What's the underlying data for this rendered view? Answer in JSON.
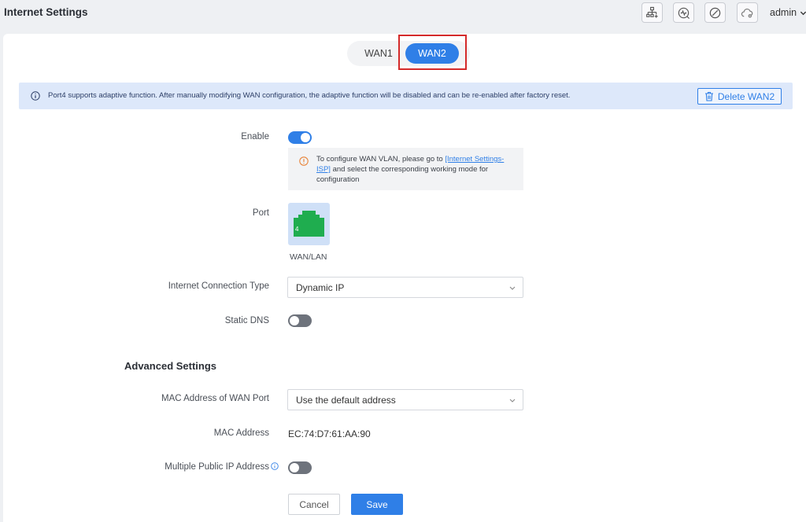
{
  "header": {
    "title": "Internet Settings",
    "icons": [
      "topology-icon",
      "diagnose-icon",
      "block-icon",
      "cloud-icon"
    ],
    "user": "admin"
  },
  "wan_tabs": [
    {
      "label": "WAN1",
      "active": false
    },
    {
      "label": "WAN2",
      "active": true
    }
  ],
  "notice": {
    "text": "Port4 supports adaptive function. After manually modifying WAN configuration, the adaptive function will be disabled and can be re-enabled after factory reset.",
    "delete_label": "Delete WAN2"
  },
  "form": {
    "enable_label": "Enable",
    "enable_on": true,
    "tip_prefix": "To configure WAN VLAN, please go to ",
    "tip_link": "[Internet Settings-ISP]",
    "tip_suffix": " and select the corresponding working mode for configuration",
    "port_label": "Port",
    "port_number": "4",
    "port_caption": "WAN/LAN",
    "connection_type_label": "Internet Connection Type",
    "connection_type_value": "Dynamic IP",
    "static_dns_label": "Static DNS",
    "static_dns_on": false
  },
  "advanced": {
    "title": "Advanced Settings",
    "mac_port_label": "MAC Address of WAN Port",
    "mac_port_value": "Use the default address",
    "mac_label": "MAC Address",
    "mac_value": "EC:74:D7:61:AA:90",
    "multi_ip_label": "Multiple Public IP Address",
    "multi_ip_on": false
  },
  "actions": {
    "cancel": "Cancel",
    "save": "Save"
  },
  "colors": {
    "accent": "#2f7fe7",
    "port_green": "#1fad4f",
    "highlight": "#d42a2a",
    "warning": "#e8843a"
  }
}
